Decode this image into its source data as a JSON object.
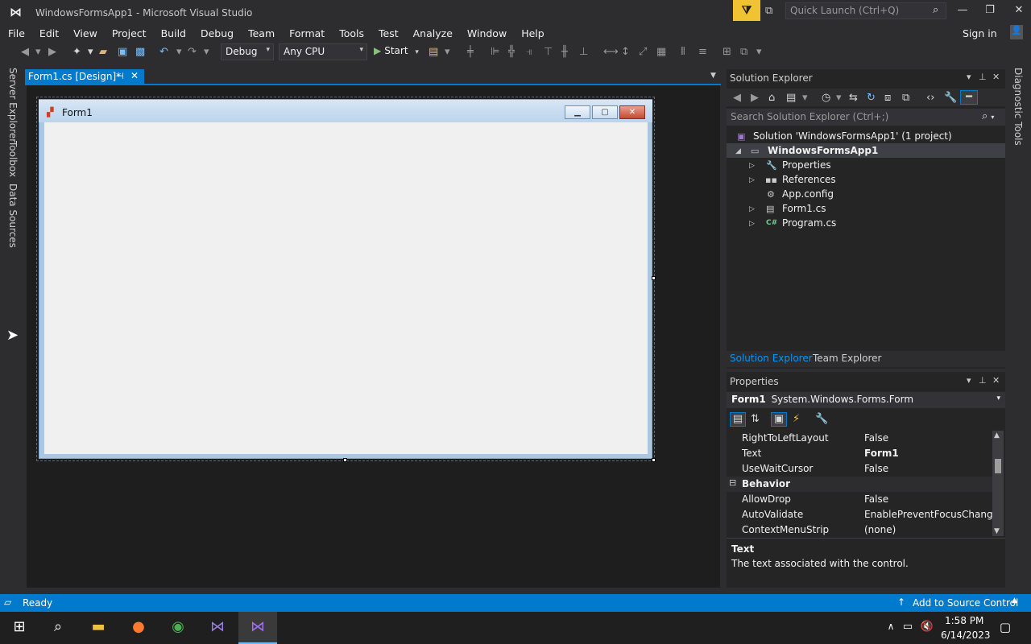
{
  "window": {
    "title": "WindowsFormsApp1 - Microsoft Visual Studio",
    "quick_launch_placeholder": "Quick Launch (Ctrl+Q)",
    "sign_in": "Sign in"
  },
  "menu": {
    "items": [
      "File",
      "Edit",
      "View",
      "Project",
      "Build",
      "Debug",
      "Team",
      "Format",
      "Tools",
      "Test",
      "Analyze",
      "Window",
      "Help"
    ]
  },
  "toolbar": {
    "configuration": "Debug",
    "platform": "Any CPU",
    "start_label": "Start"
  },
  "left_dock": {
    "tabs": [
      "Server Explorer",
      "Toolbox",
      "Data Sources"
    ]
  },
  "right_dock": {
    "tabs": [
      "Diagnostic Tools"
    ]
  },
  "document": {
    "tab_label": "Form1.cs [Design]*"
  },
  "designer": {
    "form_title": "Form1"
  },
  "solution_explorer": {
    "title": "Solution Explorer",
    "search_placeholder": "Search Solution Explorer (Ctrl+;)",
    "solution_label": "Solution 'WindowsFormsApp1' (1 project)",
    "project_label": "WindowsFormsApp1",
    "items": [
      "Properties",
      "References",
      "App.config",
      "Form1.cs",
      "Program.cs"
    ],
    "tabs": [
      "Solution Explorer",
      "Team Explorer"
    ]
  },
  "properties": {
    "title": "Properties",
    "object_name": "Form1",
    "object_type": "System.Windows.Forms.Form",
    "rows": [
      {
        "name": "RightToLeftLayout",
        "value": "False"
      },
      {
        "name": "Text",
        "value": "Form1"
      },
      {
        "name": "UseWaitCursor",
        "value": "False"
      }
    ],
    "category": "Behavior",
    "behavior_rows": [
      {
        "name": "AllowDrop",
        "value": "False"
      },
      {
        "name": "AutoValidate",
        "value": "EnablePreventFocusChange"
      },
      {
        "name": "ContextMenuStrip",
        "value": "(none)"
      }
    ],
    "desc_title": "Text",
    "desc_text": "The text associated with the control."
  },
  "status": {
    "left": "Ready",
    "right": "Add to Source Control"
  },
  "taskbar": {
    "time": "1:58 PM",
    "date": "6/14/2023"
  },
  "colors": {
    "accent": "#007acc",
    "background": "#2d2d30",
    "designer": "#1e1e1e"
  }
}
